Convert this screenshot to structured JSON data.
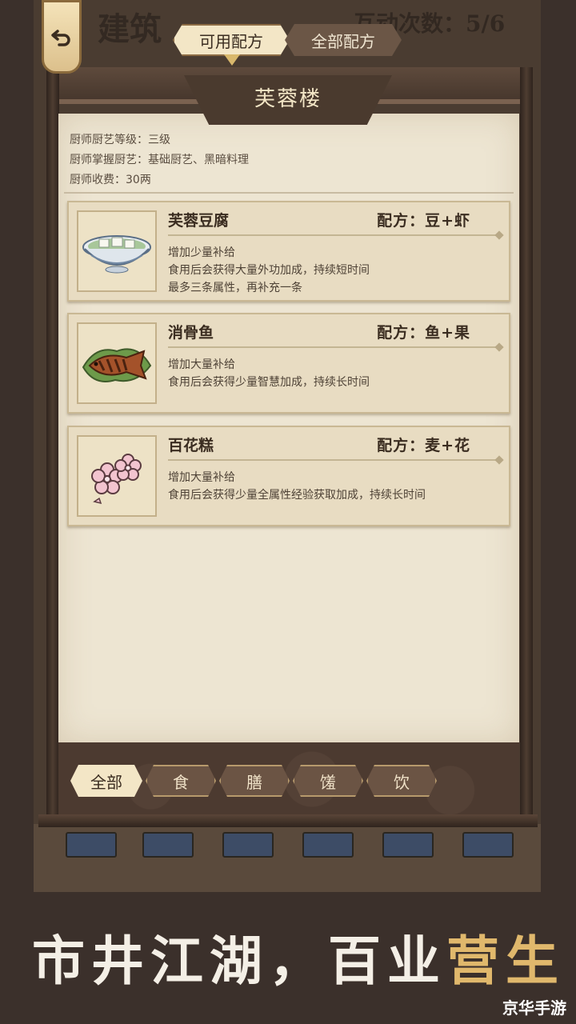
{
  "header": {
    "bg_title": "建筑",
    "bg_count": "互动次数：5/6",
    "tabs": [
      {
        "label": "可用配方",
        "active": true
      },
      {
        "label": "全部配方",
        "active": false
      }
    ]
  },
  "shop": {
    "name": "芙蓉楼",
    "info": [
      "厨师厨艺等级：三级",
      "厨师掌握厨艺：基础厨艺、黑暗料理",
      "厨师收费：30两"
    ]
  },
  "recipes": [
    {
      "name": "芙蓉豆腐",
      "recipe": "配方：豆+虾",
      "icon": "tofu-bowl-icon",
      "desc": [
        "增加少量补给",
        "食用后会获得大量外功加成，持续短时间",
        "最多三条属性，再补充一条"
      ]
    },
    {
      "name": "消骨鱼",
      "recipe": "配方：鱼+果",
      "icon": "fish-dish-icon",
      "desc": [
        "增加大量补给",
        "食用后会获得少量智慧加成，持续长时间"
      ]
    },
    {
      "name": "百花糕",
      "recipe": "配方：麦+花",
      "icon": "flower-cake-icon",
      "desc": [
        "增加大量补给",
        "食用后会获得少量全属性经验获取加成，持续长时间"
      ]
    }
  ],
  "filters": [
    {
      "label": "全部",
      "active": true
    },
    {
      "label": "食",
      "active": false
    },
    {
      "label": "膳",
      "active": false
    },
    {
      "label": "馐",
      "active": false
    },
    {
      "label": "饮",
      "active": false
    }
  ],
  "slogan": {
    "main": "市井江湖，百业",
    "highlight": "营生"
  },
  "watermark": "京华手游",
  "colors": {
    "accent": "#e0b86c",
    "panel": "#ede5d2",
    "wood": "#4a3a2e"
  }
}
